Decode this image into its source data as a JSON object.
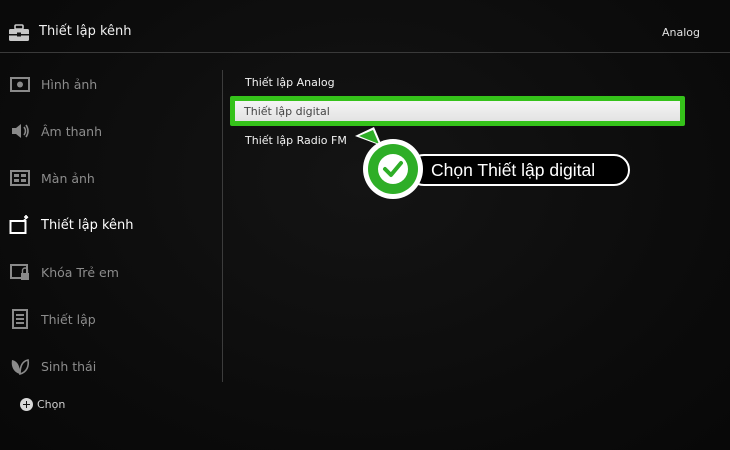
{
  "header": {
    "title": "Thiết lập kênh",
    "right_label": "Analog",
    "icon": "toolbox-icon"
  },
  "sidebar": {
    "items": [
      {
        "label": "Hình ảnh",
        "icon": "picture-icon",
        "active": false
      },
      {
        "label": "Âm thanh",
        "icon": "speaker-icon",
        "active": false
      },
      {
        "label": "Màn ảnh",
        "icon": "screen-layout-icon",
        "active": false
      },
      {
        "label": "Thiết lập kênh",
        "icon": "channel-setup-icon",
        "active": true
      },
      {
        "label": "Khóa Trẻ em",
        "icon": "child-lock-icon",
        "active": false
      },
      {
        "label": "Thiết lập",
        "icon": "settings-list-icon",
        "active": false
      },
      {
        "label": "Sinh thái",
        "icon": "eco-leaf-icon",
        "active": false
      }
    ]
  },
  "footer": {
    "hint_label": "Chọn",
    "hint_icon": "select-button-icon"
  },
  "menu": {
    "items": [
      {
        "label": "Thiết lập Analog",
        "selected": false
      },
      {
        "label": "Thiết lập digital",
        "selected": true
      },
      {
        "label": "Thiết lập Radio FM",
        "selected": false
      }
    ]
  },
  "annotation": {
    "label": "Chọn Thiết lập digital",
    "icon": "checkmark-icon"
  },
  "colors": {
    "highlight": "#35c21a",
    "callout_green": "#2eae27",
    "background": "#0c0c0c"
  }
}
